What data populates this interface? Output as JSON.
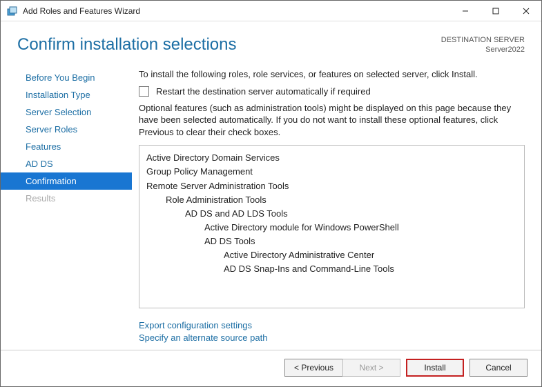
{
  "window": {
    "title": "Add Roles and Features Wizard"
  },
  "header": {
    "title": "Confirm installation selections",
    "dest_label": "DESTINATION SERVER",
    "dest_value": "Server2022"
  },
  "nav": {
    "items": [
      {
        "label": "Before You Begin",
        "state": "normal"
      },
      {
        "label": "Installation Type",
        "state": "normal"
      },
      {
        "label": "Server Selection",
        "state": "normal"
      },
      {
        "label": "Server Roles",
        "state": "normal"
      },
      {
        "label": "Features",
        "state": "normal"
      },
      {
        "label": "AD DS",
        "state": "normal"
      },
      {
        "label": "Confirmation",
        "state": "selected"
      },
      {
        "label": "Results",
        "state": "disabled"
      }
    ]
  },
  "main": {
    "intro": "To install the following roles, role services, or features on selected server, click Install.",
    "restart_label": "Restart the destination server automatically if required",
    "note": "Optional features (such as administration tools) might be displayed on this page because they have been selected automatically. If you do not want to install these optional features, click Previous to clear their check boxes.",
    "features": [
      {
        "level": 0,
        "text": "Active Directory Domain Services"
      },
      {
        "level": 0,
        "text": "Group Policy Management"
      },
      {
        "level": 0,
        "text": "Remote Server Administration Tools"
      },
      {
        "level": 1,
        "text": "Role Administration Tools"
      },
      {
        "level": 2,
        "text": "AD DS and AD LDS Tools"
      },
      {
        "level": 3,
        "text": "Active Directory module for Windows PowerShell"
      },
      {
        "level": 3,
        "text": "AD DS Tools"
      },
      {
        "level": 4,
        "text": "Active Directory Administrative Center"
      },
      {
        "level": 4,
        "text": "AD DS Snap-Ins and Command-Line Tools"
      }
    ],
    "links": {
      "export": "Export configuration settings",
      "source": "Specify an alternate source path"
    }
  },
  "footer": {
    "previous": "< Previous",
    "next": "Next >",
    "install": "Install",
    "cancel": "Cancel"
  }
}
